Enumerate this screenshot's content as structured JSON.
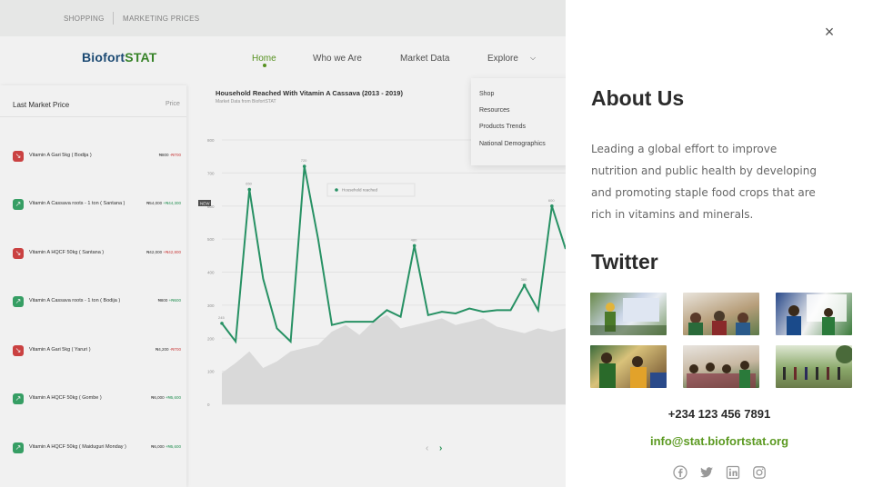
{
  "topbar": {
    "links": [
      "SHOPPING",
      "MARKETING PRICES"
    ]
  },
  "brand": {
    "part1": "Biofort",
    "part2": "STAT"
  },
  "nav": {
    "items": [
      "Home",
      "Who we Are",
      "Market Data",
      "Explore"
    ],
    "active": "Home"
  },
  "explore_menu": [
    "Shop",
    "Resources",
    "Products Trends",
    "National Demographics"
  ],
  "last_market": {
    "title": "Last Market Price",
    "col": "Price",
    "rows": [
      {
        "name": "Vitamin A Gari 5kg ( Bodija )",
        "price": "₦800",
        "change": "-₦700",
        "dir": "down"
      },
      {
        "name": "Vitamin A Cassava roots - 1 ton ( Santana )",
        "price": "₦54,000",
        "change": "+₦44,300",
        "dir": "up"
      },
      {
        "name": "Vitamin A HQCF 50kg ( Santana )",
        "price": "₦42,000",
        "change": "+₦42,800",
        "dir": "down"
      },
      {
        "name": "Vitamin A Cassava roots - 1 ton ( Bodija )",
        "price": "₦800",
        "change": "+₦600",
        "dir": "up"
      },
      {
        "name": "Vitamin A Gari 5kg ( Yaruri )",
        "price": "₦4,200",
        "change": "-₦700",
        "dir": "down"
      },
      {
        "name": "Vitamin A HQCF 50kg ( Gombe )",
        "price": "₦6,000",
        "change": "+₦5,600",
        "dir": "up"
      },
      {
        "name": "Vitamin A HQCF 50kg ( Maiduguri Monday )",
        "price": "₦6,000",
        "change": "+₦5,600",
        "dir": "up"
      }
    ]
  },
  "chart": {
    "title": "Household Reached With Vitamin A Cassava (2013 - 2019)",
    "subtitle": "Market Data from BiofortSTAT",
    "legend": "Household reached",
    "badge": "NEW"
  },
  "chart_data": {
    "type": "line",
    "y_ticks": [
      "800",
      "700",
      "600",
      "500",
      "400",
      "300",
      "200",
      "100",
      "0"
    ],
    "ylim": [
      0,
      800
    ],
    "series": [
      {
        "name": "Household reached",
        "values": [
          245,
          190,
          650,
          380,
          230,
          190,
          720,
          500,
          240,
          250,
          250,
          250,
          285,
          265,
          480,
          270,
          280,
          275,
          290,
          280,
          285,
          285,
          360,
          285,
          600,
          470
        ]
      },
      {
        "values": [
          95,
          125,
          160,
          110,
          130,
          160,
          170,
          180,
          220,
          240,
          210,
          250,
          270,
          230,
          240,
          250,
          260,
          240,
          250,
          260,
          235,
          225,
          215,
          230,
          220,
          230
        ]
      }
    ],
    "point_labels": [
      "245",
      "650",
      "720",
      "480",
      "360",
      "600"
    ]
  },
  "drawer": {
    "about_title": "About Us",
    "about_text": "Leading a global effort to improve nutrition and public health by developing and promoting staple food crops that are rich in vitamins and minerals.",
    "twitter_title": "Twitter",
    "phone": "+234 123 456 7891",
    "email": "info@stat.biofortstat.org",
    "close_icon": "close-icon",
    "socials": [
      "facebook-icon",
      "twitter-icon",
      "linkedin-icon",
      "instagram-icon"
    ]
  }
}
